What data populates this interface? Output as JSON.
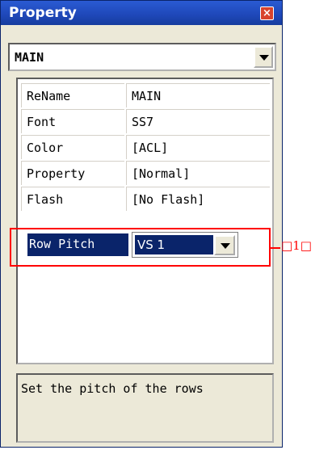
{
  "window": {
    "title": "Property",
    "close_label": "×"
  },
  "object_combo": {
    "value": "MAIN"
  },
  "properties": [
    {
      "name": "ReName",
      "value": "MAIN"
    },
    {
      "name": "Font",
      "value": "SS7"
    },
    {
      "name": "Color",
      "value": "[ACL]"
    },
    {
      "name": "Property",
      "value": "[Normal]"
    },
    {
      "name": "Flash",
      "value": "[No Flash]"
    }
  ],
  "selected_property": {
    "name": "Row Pitch",
    "value": "VS 1"
  },
  "callout": {
    "label": "□1□",
    "color": "#ff0000"
  },
  "description": "Set the pitch of the rows",
  "colors": {
    "titlebar": "#1e47b8",
    "selection": "#0a246a",
    "panel": "#ece9d8"
  }
}
